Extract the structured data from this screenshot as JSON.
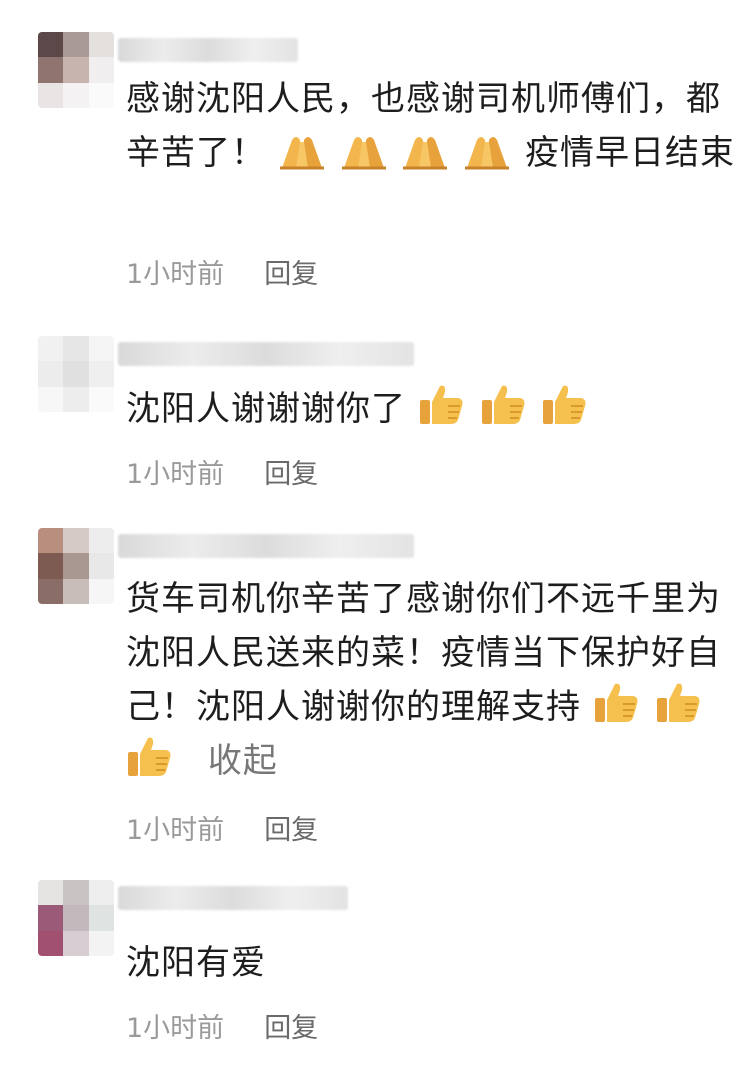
{
  "comments": [
    {
      "text_before": "感谢沈阳人民，也感谢司机师傅们，都辛苦了！",
      "emoji_icon": "folded-hands-icon",
      "emoji_count": 4,
      "text_after": "疫情早日结束",
      "time": "1小时前",
      "reply": "回复"
    },
    {
      "text_before": "沈阳人谢谢谢你了",
      "emoji_icon": "thumbs-up-icon",
      "emoji_count": 3,
      "time": "1小时前",
      "reply": "回复"
    },
    {
      "text_before": "货车司机你辛苦了感谢你们不远千里为沈阳人民送来的菜！疫情当下保护好自己！沈阳人谢谢你的理解支持",
      "emoji_icon": "thumbs-up-icon",
      "emoji_count": 3,
      "collapse": "收起",
      "time": "1小时前",
      "reply": "回复"
    },
    {
      "text_before": "沈阳有爱",
      "time": "1小时前",
      "reply": "回复"
    }
  ]
}
